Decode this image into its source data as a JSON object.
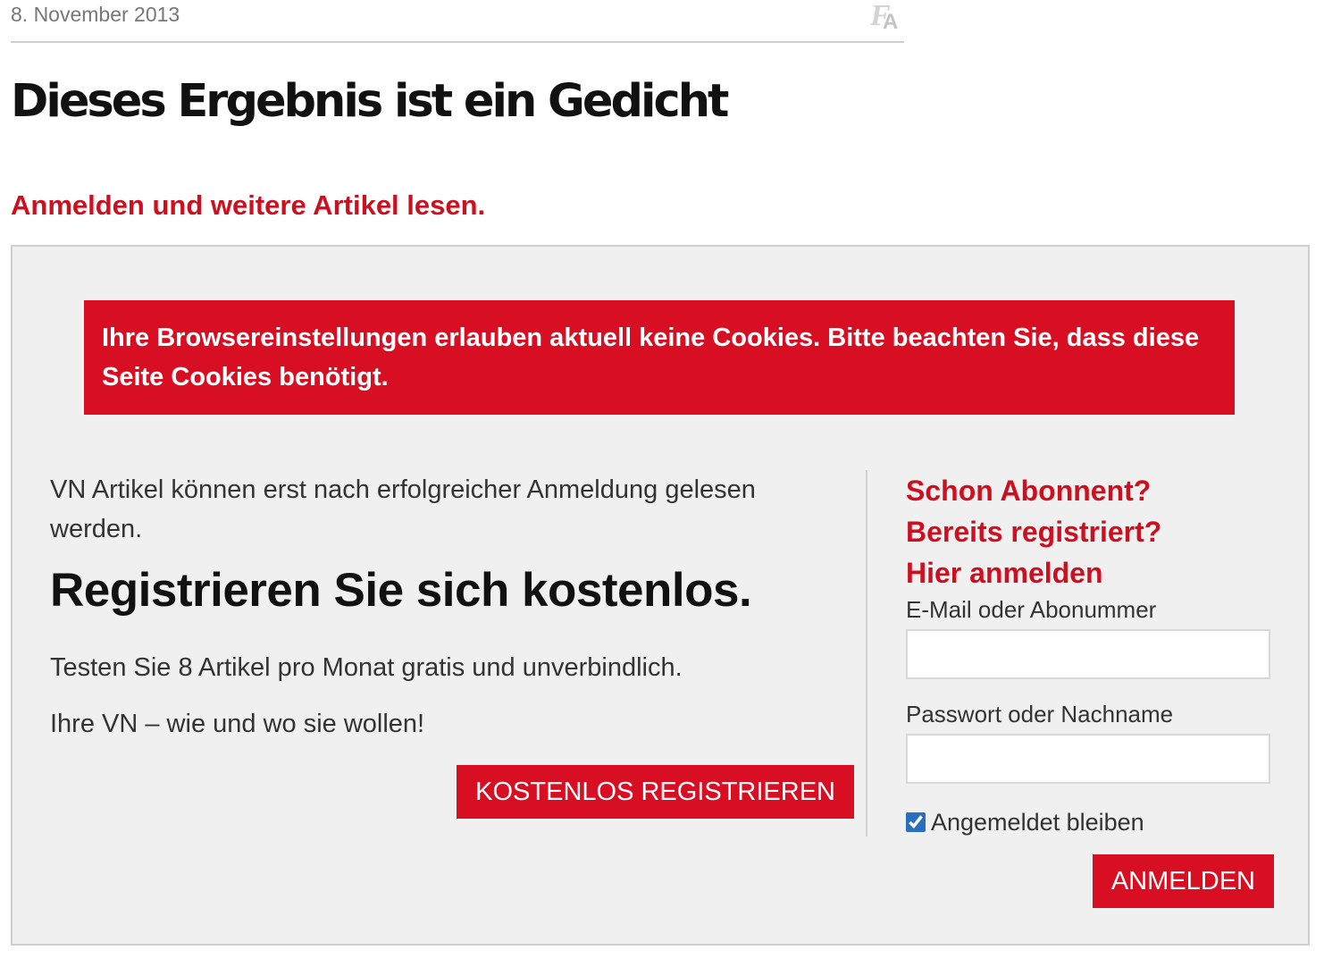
{
  "article": {
    "date": "8. November 2013",
    "headline": "Dieses Ergebnis ist ein Gedicht",
    "font_size_icon": "font-size-icon"
  },
  "paywall": {
    "prompt": "Anmelden und weitere Artikel lesen.",
    "cookie_alert": "Ihre Browsereinstellungen erlauben aktuell keine Cookies. Bitte beachten Sie, dass diese Seite Cookies benötigt.",
    "intro": "VN Artikel können erst nach erfolgreicher Anmeldung gelesen werden.",
    "register_title": "Registrieren Sie sich kostenlos.",
    "test_line": "Testen Sie 8 Artikel pro Monat gratis und unverbindlich.",
    "slogan": "Ihre VN – wie und wo sie wollen!",
    "register_button": "KOSTENLOS REGISTRIEREN"
  },
  "login": {
    "headline_1": "Schon Abonnent?",
    "headline_2": "Bereits registriert?",
    "headline_3": "Hier anmelden",
    "email_label": "E-Mail oder Abonummer",
    "email_value": "",
    "password_label": "Passwort oder Nachname",
    "password_value": "",
    "remember_label": "Angemeldet bleiben",
    "remember_checked": true,
    "login_button": "ANMELDEN"
  },
  "colors": {
    "accent_red": "#d80f23",
    "link_red": "#cc1020",
    "panel_bg": "#f0f0f0",
    "border_gray": "#cfcfcf"
  }
}
